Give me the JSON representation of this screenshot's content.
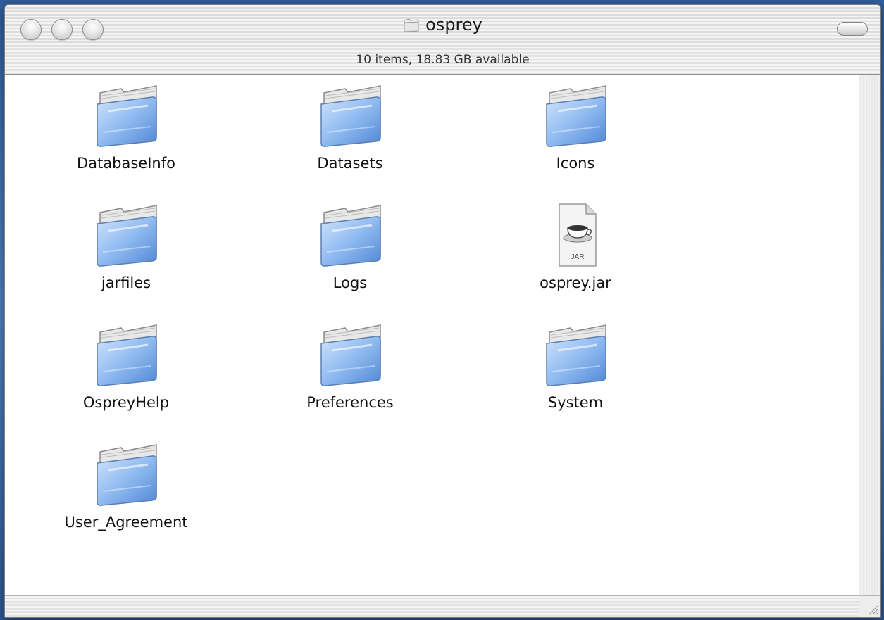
{
  "window": {
    "title": "osprey",
    "status": "10 items, 18.83 GB available"
  },
  "items": [
    {
      "name": "DatabaseInfo",
      "kind": "folder"
    },
    {
      "name": "Datasets",
      "kind": "folder"
    },
    {
      "name": "Icons",
      "kind": "folder"
    },
    {
      "name": "jarfiles",
      "kind": "folder"
    },
    {
      "name": "Logs",
      "kind": "folder"
    },
    {
      "name": "osprey.jar",
      "kind": "jar",
      "badge": "JAR"
    },
    {
      "name": "OspreyHelp",
      "kind": "folder"
    },
    {
      "name": "Preferences",
      "kind": "folder"
    },
    {
      "name": "System",
      "kind": "folder"
    },
    {
      "name": "User_Agreement",
      "kind": "folder"
    }
  ],
  "colors": {
    "folder_light": "#cfe3fb",
    "folder_mid": "#8fbaf0",
    "folder_dark": "#4f86d6",
    "desktop": "#3a6aa8"
  }
}
